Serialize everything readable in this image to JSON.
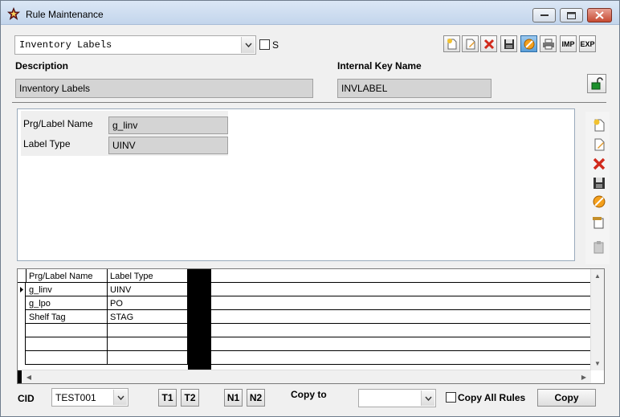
{
  "window": {
    "title": "Rule Maintenance",
    "icon": "star-icon"
  },
  "top": {
    "rule_select_value": "Inventory Labels",
    "s_checkbox_label": "S",
    "s_checked": false,
    "description_label": "Description",
    "description_value": "Inventory Labels",
    "internal_key_label": "Internal Key Name",
    "internal_key_value": "INVLABEL"
  },
  "toolbar": {
    "imp_label": "IMP",
    "exp_label": "EXP"
  },
  "form": {
    "prg_label": "Prg/Label Name",
    "prg_value": "g_linv",
    "type_label": "Label Type",
    "type_value": "UINV"
  },
  "grid": {
    "columns": [
      "Prg/Label Name",
      "Label Type"
    ],
    "rows": [
      [
        "g_linv",
        "UINV"
      ],
      [
        "g_lpo",
        "PO"
      ],
      [
        "Shelf Tag",
        "STAG"
      ],
      [
        "",
        ""
      ],
      [
        "",
        ""
      ],
      [
        "",
        ""
      ]
    ],
    "selected_row": 0
  },
  "bottom": {
    "cid_label": "CID",
    "cid_value": "TEST001",
    "t1": "T1",
    "t2": "T2",
    "n1": "N1",
    "n2": "N2",
    "copy_to_label": "Copy to",
    "copy_to_value": "",
    "copy_all_label": "Copy All Rules",
    "copy_all_checked": false,
    "copy_button": "Copy"
  },
  "colors": {
    "readonly_bg": "#d4d4d4",
    "titlebar": "#c3d5ec",
    "close_red": "#c74b33",
    "active_tool": "#5b9fd8"
  }
}
